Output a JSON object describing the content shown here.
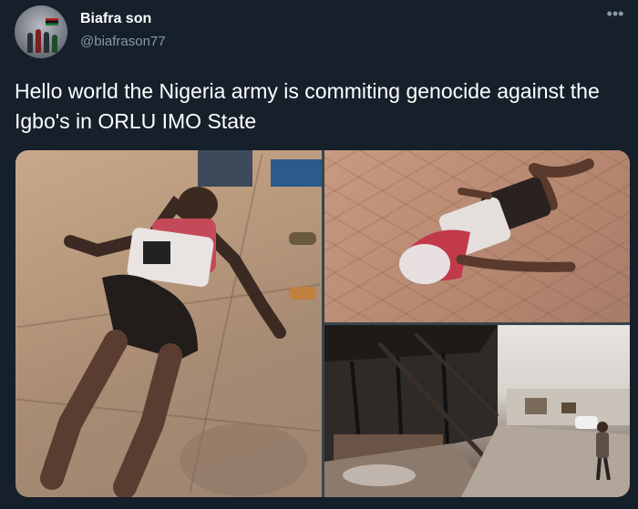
{
  "author": {
    "display_name": "Biafra son",
    "handle": "@biafrason77"
  },
  "more_icon": "•••",
  "tweet": {
    "text": "Hello world the Nigeria army is commiting genocide against the Igbo's in ORLU IMO State"
  },
  "media": {
    "photos": [
      {
        "icon": "photo-1"
      },
      {
        "icon": "photo-2"
      },
      {
        "icon": "photo-3"
      }
    ]
  },
  "colors": {
    "background": "#15202b",
    "primary_text": "#ffffff",
    "secondary_text": "#8899a6"
  }
}
